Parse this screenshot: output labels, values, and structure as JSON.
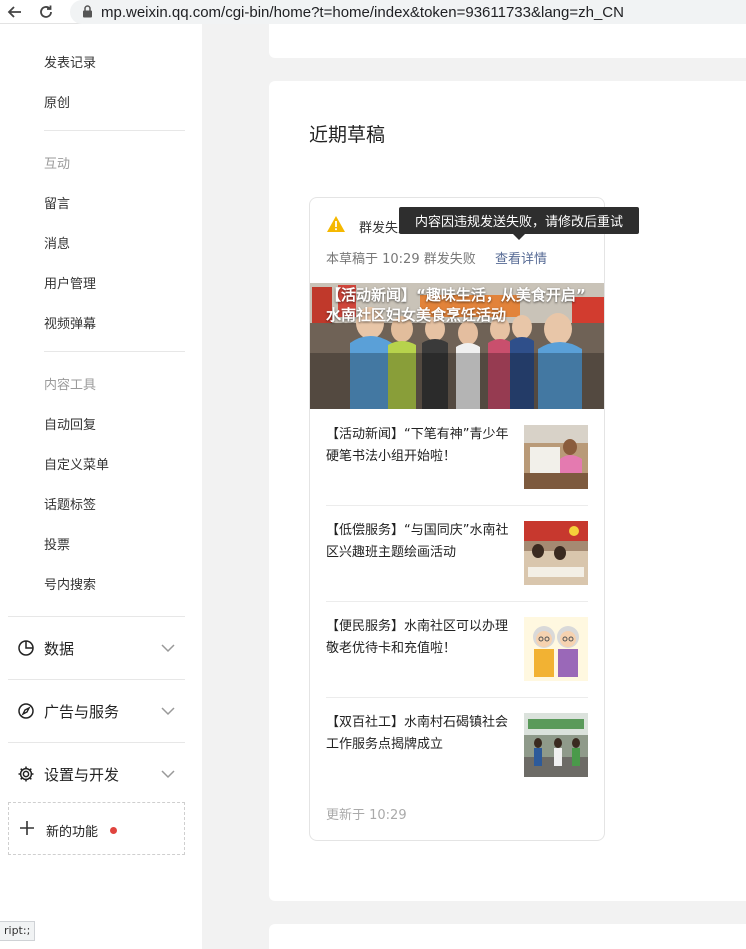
{
  "browser": {
    "url": "mp.weixin.qq.com/cgi-bin/home?t=home/index&token=93611733&lang=zh_CN",
    "status_tooltip": "ript:;"
  },
  "sidebar": {
    "items_top": [
      "发表记录",
      "原创"
    ],
    "group_interaction": "互动",
    "interaction_items": [
      "留言",
      "消息",
      "用户管理",
      "视频弹幕"
    ],
    "group_tools": "内容工具",
    "tool_items": [
      "自动回复",
      "自定义菜单",
      "话题标签",
      "投票",
      "号内搜索"
    ],
    "sections": [
      {
        "label": "数据",
        "icon": "pie-chart-icon"
      },
      {
        "label": "广告与服务",
        "icon": "compass-icon"
      },
      {
        "label": "设置与开发",
        "icon": "gear-icon"
      }
    ],
    "new_feature": {
      "label": "新的功能",
      "icon": "plus-icon",
      "badge_color": "#e0443e"
    }
  },
  "main": {
    "title": "近期草稿",
    "draft": {
      "status_title": "群发失败",
      "status_detail": "本草稿于 10:29 群发失败",
      "detail_link": "查看详情",
      "tooltip": "内容因违规发送失败，请修改后重试",
      "cover_title": "【活动新闻】“趣味生活，从美食开启” 水南社区妇女美食烹饪活动",
      "articles": [
        {
          "title": "【活动新闻】“下笔有神”青少年硬笔书法小组开始啦！"
        },
        {
          "title": "【低偿服务】“与国同庆”水南社区兴趣班主题绘画活动"
        },
        {
          "title": "【便民服务】水南社区可以办理敬老优待卡和充值啦！"
        },
        {
          "title": "【双百社工】水南村石碣镇社会工作服务点揭牌成立"
        }
      ],
      "updated": "更新于 10:29"
    }
  },
  "colors": {
    "warning": "#f5b800",
    "link": "#576b95",
    "tooltip_bg": "#2e2e2e"
  }
}
